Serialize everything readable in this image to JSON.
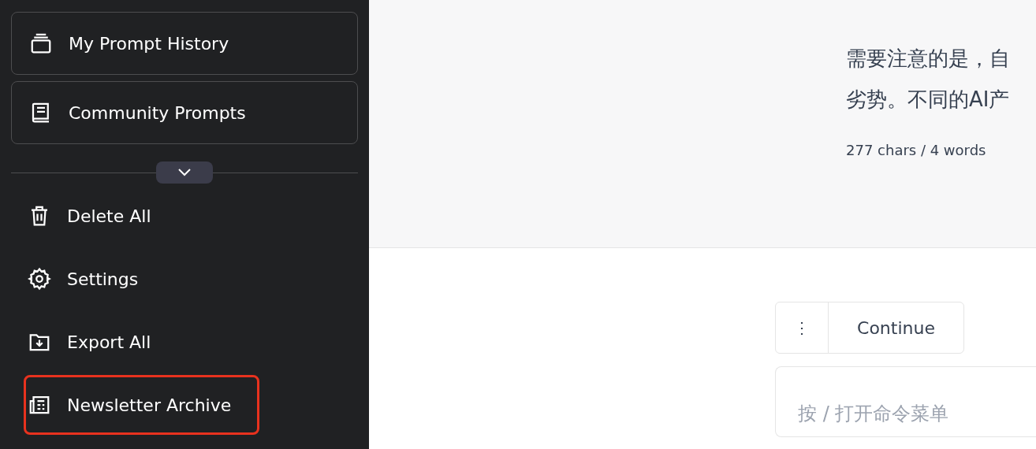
{
  "sidebar": {
    "cards": [
      {
        "label": "My Prompt History"
      },
      {
        "label": "Community Prompts"
      }
    ],
    "collapse_toggle": {
      "expanded": false
    },
    "items": [
      {
        "label": "Delete All",
        "highlighted": false
      },
      {
        "label": "Settings",
        "highlighted": false
      },
      {
        "label": "Export All",
        "highlighted": false
      },
      {
        "label": "Newsletter Archive",
        "highlighted": true
      }
    ]
  },
  "response": {
    "lines": [
      "需要注意的是，自",
      "劣势。不同的AI产"
    ],
    "count": "277 chars / 4 words"
  },
  "actions": {
    "more": "⋮",
    "continue": "Continue"
  },
  "prompt_input": {
    "placeholder": "按 / 打开命令菜单"
  }
}
